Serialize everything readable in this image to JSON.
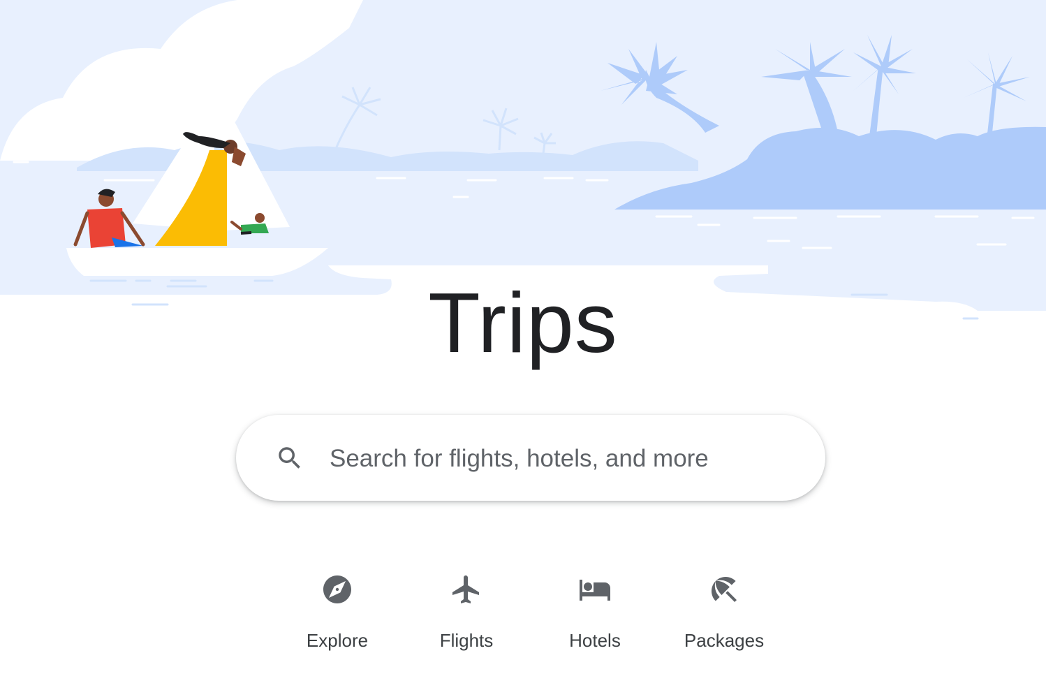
{
  "page": {
    "title": "Trips"
  },
  "colors": {
    "sky": "#e8f0fe",
    "island": "#aecbfa",
    "palm": "#aecbfa",
    "text": "#202124",
    "icon": "#5f6368"
  },
  "search": {
    "icon": "search-icon",
    "placeholder": "Search for flights, hotels, and more",
    "value": ""
  },
  "nav": {
    "items": [
      {
        "label": "Explore",
        "icon": "compass-icon"
      },
      {
        "label": "Flights",
        "icon": "airplane-icon"
      },
      {
        "label": "Hotels",
        "icon": "bed-icon"
      },
      {
        "label": "Packages",
        "icon": "beach-umbrella-icon"
      }
    ]
  }
}
